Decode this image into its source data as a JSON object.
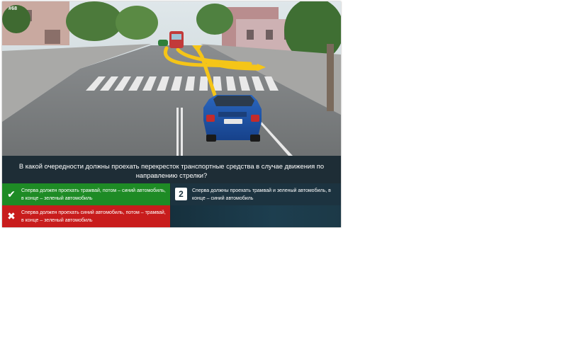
{
  "question_number": "#68",
  "question_text": "В какой очередности должны проехать перекресток транспортные средства в случае движения по направлению стрелки?",
  "answers": [
    {
      "id": "a1",
      "text": "Сперва должен проехать трамвай, потом – синий автомобиль, в конце – зеленый автомобиль",
      "status": "correct",
      "icon": "check-icon"
    },
    {
      "id": "a2",
      "number": "2",
      "text": "Сперва должны проехать трамвай и зеленый автомобиль, в конце – синий автомобиль",
      "status": "neutral"
    },
    {
      "id": "a3",
      "text": "Сперва должен проехать синий автомобиль, потом – трамвай, в конце – зеленый автомобиль",
      "status": "wrong",
      "icon": "cross-icon"
    }
  ],
  "car_plate": "BMA-0000",
  "colors": {
    "correct": "#1e8b25",
    "wrong": "#c81c1c",
    "panel": "#1e2d36",
    "arrow": "#f5c518",
    "car": "#1f56a8"
  }
}
